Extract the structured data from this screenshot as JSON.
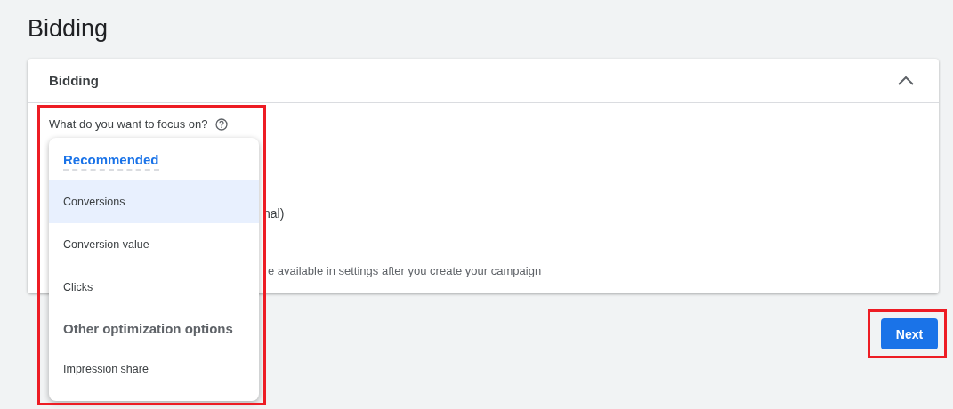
{
  "page_title": "Bidding",
  "card": {
    "title": "Bidding",
    "expanded": true,
    "question": "What do you want to focus on?",
    "hidden_texts": [
      "nal)",
      "e available in settings after you create your campaign"
    ]
  },
  "menu": {
    "items": [
      {
        "kind": "header",
        "label": "Recommended"
      },
      {
        "kind": "option",
        "label": "Conversions",
        "selected": true
      },
      {
        "kind": "option",
        "label": "Conversion value",
        "selected": false
      },
      {
        "kind": "option",
        "label": "Clicks",
        "selected": false
      },
      {
        "kind": "header",
        "label": "Other optimization options"
      },
      {
        "kind": "option",
        "label": "Impression share",
        "selected": false
      }
    ]
  },
  "next_button": "Next"
}
